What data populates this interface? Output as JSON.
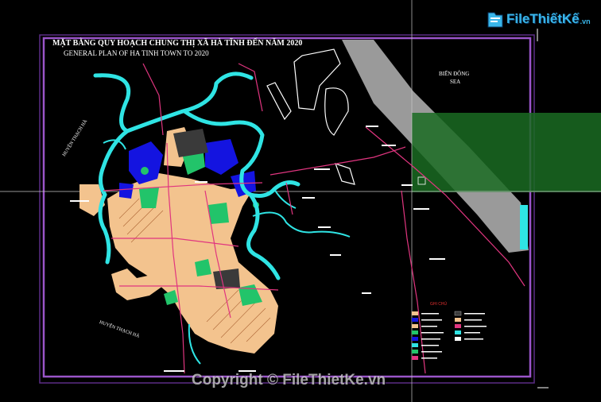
{
  "drawing": {
    "title_vi": "MẶT BẰNG QUY HOẠCH CHUNG THỊ XÃ HÀ TĨNH ĐẾN NĂM 2020",
    "title_en": "GENERAL PLAN OF HA TINH TOWN TO 2020",
    "sea_label_vi": "BIỂN ĐÔNG",
    "sea_label_en": "SEA",
    "district_left": "HUYỆN THẠCH HÀ",
    "district_bottom": "HUYỆN THẠCH HÀ",
    "legend_title": "GHI CHÚ"
  },
  "branding": {
    "logo_text": "FileThiếtKế",
    "logo_domain": ".vn",
    "watermark": "Copyright © FileThietKe.vn"
  },
  "colors": {
    "background": "#000000",
    "frame": "#9a55c9",
    "river": "#2fe4e4",
    "road": "#e0357f",
    "residential": "#f3c38e",
    "water_blue": "#1414e0",
    "green_park": "#22c46a",
    "sea_band": "#9a9a9a",
    "selection_band": "#1a6b22",
    "crosshair": "#c8c8c8"
  },
  "icons": {
    "logo": "logo-folder-icon"
  }
}
